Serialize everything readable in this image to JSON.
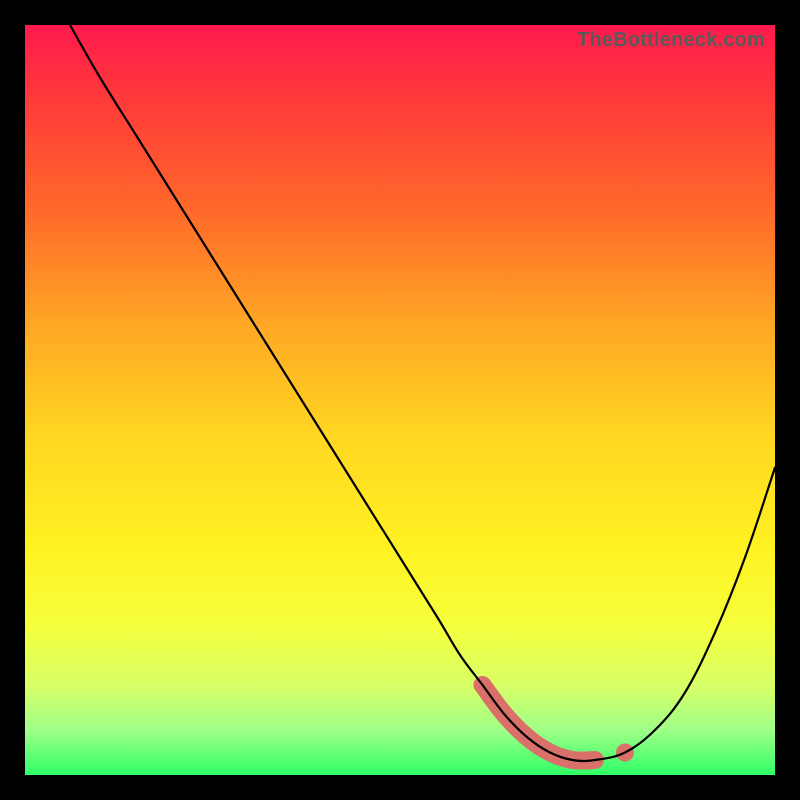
{
  "watermark": "TheBottleneck.com",
  "chart_data": {
    "type": "line",
    "title": "",
    "xlabel": "",
    "ylabel": "",
    "xlim": [
      0,
      100
    ],
    "ylim": [
      0,
      100
    ],
    "grid": false,
    "legend": false,
    "series": [
      {
        "name": "curve",
        "x": [
          6,
          10,
          15,
          20,
          25,
          30,
          35,
          40,
          45,
          50,
          55,
          58,
          61,
          64,
          67,
          70,
          73,
          76,
          80,
          84,
          88,
          92,
          96,
          100
        ],
        "values": [
          100,
          93,
          85,
          77,
          69,
          61,
          53,
          45,
          37,
          29,
          21,
          16,
          12,
          8,
          5,
          3,
          2,
          2,
          3,
          6,
          11,
          19,
          29,
          41
        ]
      }
    ],
    "highlight": {
      "name": "optimal-range",
      "x": [
        61,
        64,
        67,
        70,
        73,
        76
      ],
      "values": [
        12,
        8,
        5,
        3,
        2,
        2
      ]
    },
    "highlight_dot": {
      "x": 80,
      "y": 3
    },
    "gradient_stops": [
      {
        "pos": 0,
        "color": "#ff1a4d"
      },
      {
        "pos": 25,
        "color": "#ff6a2a"
      },
      {
        "pos": 55,
        "color": "#ffd721"
      },
      {
        "pos": 80,
        "color": "#f5ff3c"
      },
      {
        "pos": 100,
        "color": "#2fff66"
      }
    ]
  }
}
